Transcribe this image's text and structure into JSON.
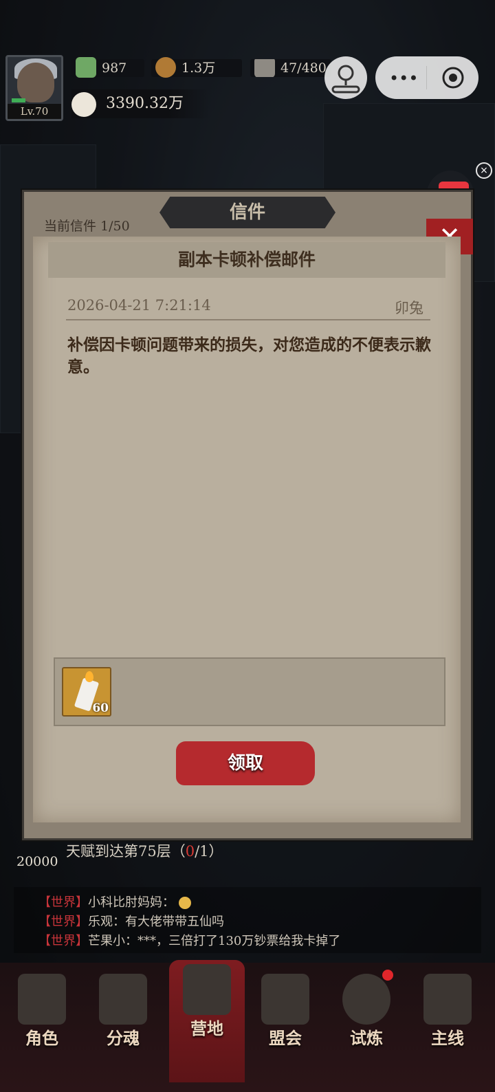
{
  "player": {
    "level": "Lv.70",
    "power": "3390.32万"
  },
  "resources": [
    {
      "icon": "cash-icon",
      "value": "987"
    },
    {
      "icon": "coin-bag-icon",
      "value": "1.3万"
    },
    {
      "icon": "stamina-icon",
      "value": "47/480"
    }
  ],
  "letter": {
    "panel_title": "信件",
    "counter": "当前信件 1/50",
    "subject": "副本卡顿补偿邮件",
    "date": "2026-04-21 7:21:14",
    "sender": "卯兔",
    "body": "补偿因卡顿问题带来的损失，对您造成的不便表示歉意。",
    "reward": {
      "icon": "candle-icon",
      "quantity": "60"
    },
    "claim_label": "领取"
  },
  "talent_quest": {
    "text_before": "天赋到达第75层（",
    "progress": "0",
    "text_after": "/1）"
  },
  "quest_reward_amount": "20000",
  "chat": [
    {
      "channel": "【世界】",
      "message": "小科比肘妈妈："
    },
    {
      "channel": "【世界】",
      "message": "乐观：有大佬带带五仙吗"
    },
    {
      "channel": "【世界】",
      "message": "芒果小：***，三倍打了130万钞票给我卡掉了"
    }
  ],
  "nav": [
    {
      "label": "角色"
    },
    {
      "label": "分魂"
    },
    {
      "label": "营地"
    },
    {
      "label": "盟会"
    },
    {
      "label": "试炼"
    },
    {
      "label": "主线"
    }
  ],
  "colors": {
    "accent_red": "#b52a2e",
    "paper": "#b9af9e"
  }
}
